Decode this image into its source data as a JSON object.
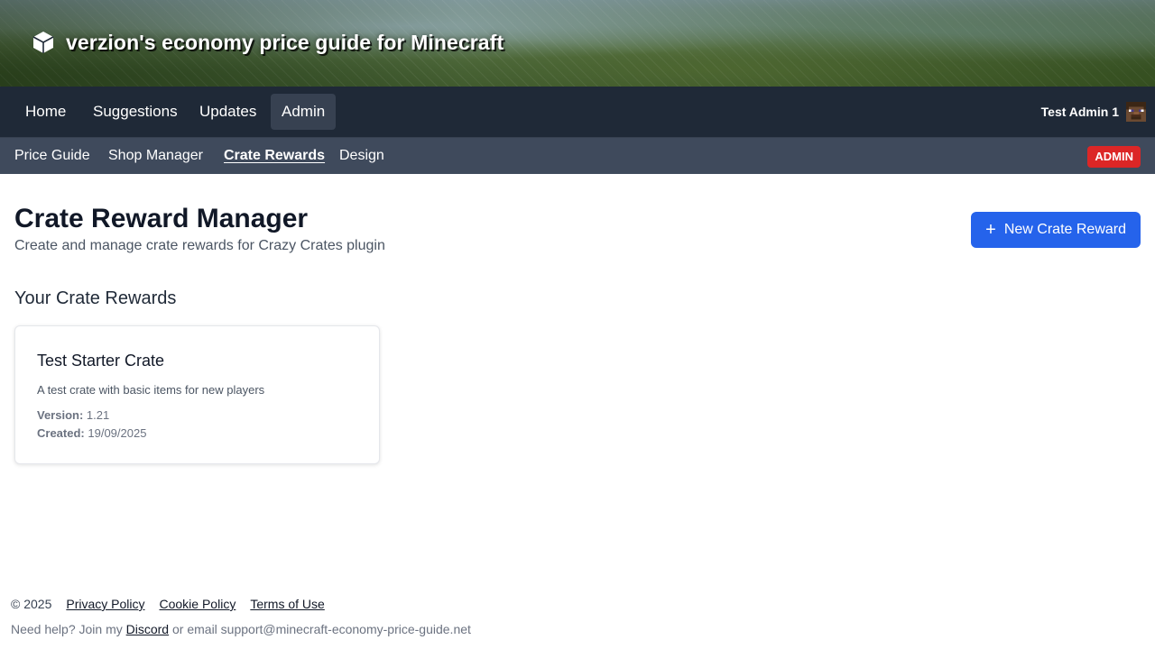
{
  "site": {
    "title": "verzion's economy price guide for Minecraft",
    "logo_icon": "cube-icon"
  },
  "nav": {
    "items": [
      {
        "label": "Home",
        "active": false
      },
      {
        "label": "Suggestions",
        "active": false
      },
      {
        "label": "Updates",
        "active": false
      },
      {
        "label": "Admin",
        "active": true
      }
    ],
    "user": {
      "name": "Test Admin 1",
      "avatar_icon": "steve-avatar-icon"
    }
  },
  "subnav": {
    "items": [
      {
        "label": "Price Guide",
        "active": false
      },
      {
        "label": "Shop Manager",
        "active": false
      },
      {
        "label": "Crate Rewards",
        "active": true
      },
      {
        "label": "Design",
        "active": false
      }
    ],
    "badge": "ADMIN"
  },
  "main": {
    "title": "Crate Reward Manager",
    "subtitle": "Create and manage crate rewards for Crazy Crates plugin",
    "new_button": {
      "icon": "plus-icon",
      "label": "New Crate Reward"
    },
    "section_title": "Your Crate Rewards",
    "cards": [
      {
        "title": "Test Starter Crate",
        "description": "A test crate with basic items for new players",
        "version_label": "Version:",
        "version": "1.21",
        "created_label": "Created:",
        "created": "19/09/2025"
      }
    ]
  },
  "footer": {
    "copyright": "© 2025",
    "links": [
      "Privacy Policy",
      "Cookie Policy",
      "Terms of Use"
    ],
    "help_prefix": "Need help? Join my",
    "discord": "Discord",
    "help_suffix": "or email support@minecraft-economy-price-guide.net"
  },
  "colors": {
    "nav_bg": "#1f2937",
    "subnav_bg": "#3f4a5c",
    "accent": "#2563eb",
    "badge": "#dc2626"
  }
}
